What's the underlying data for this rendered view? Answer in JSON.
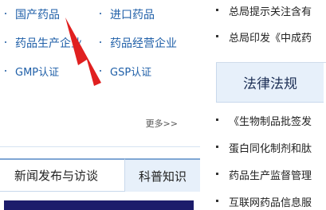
{
  "quick_links": {
    "items": [
      {
        "label": "国产药品"
      },
      {
        "label": "进口药品"
      },
      {
        "label": "药品生产企业"
      },
      {
        "label": "药品经营企业"
      },
      {
        "label": "GMP认证"
      },
      {
        "label": "GSP认证"
      }
    ],
    "more_label": "更多>>"
  },
  "left_tabs": {
    "active": "新闻发布与访谈",
    "inactive": "科普知识"
  },
  "top_news": [
    "总局提示关注含有",
    "总局印发《中成药"
  ],
  "law_section": {
    "title": "法律法规",
    "items": [
      "《生物制品批签发",
      "蛋白同化制剂和肽",
      "药品生产监督管理",
      "互联网药品信息服"
    ]
  },
  "colors": {
    "link": "#1f5fa8",
    "tab_bg": "#e7f0fa",
    "arrow": "#e02020",
    "strip": "#1c1c6b"
  }
}
